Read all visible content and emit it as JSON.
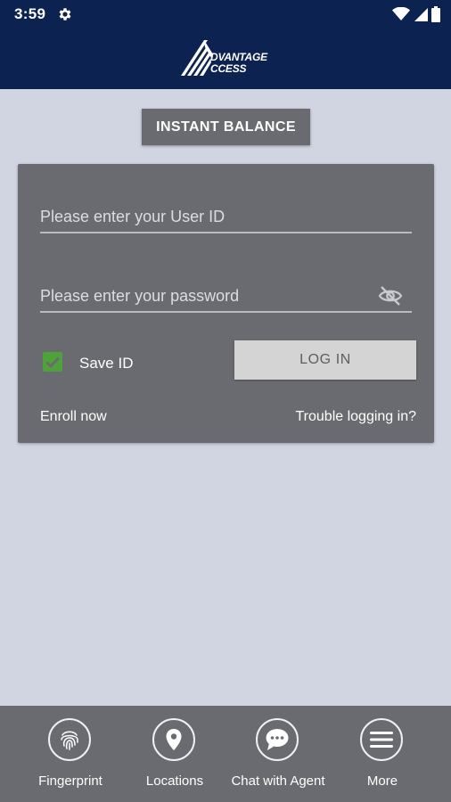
{
  "status_bar": {
    "time": "3:59",
    "icons": [
      "settings-gear",
      "wifi",
      "signal",
      "battery"
    ]
  },
  "header": {
    "logo_line1": "DVANTAGE",
    "logo_line2": "CCESS"
  },
  "instant_balance_label": "INSTANT BALANCE",
  "login": {
    "userid_placeholder": "Please enter your User ID",
    "userid_value": "",
    "password_placeholder": "Please enter your password",
    "password_value": "",
    "save_id_label": "Save ID",
    "save_id_checked": true,
    "login_button_label": "LOG IN",
    "enroll_label": "Enroll now",
    "trouble_label": "Trouble logging in?"
  },
  "bottom_nav": {
    "items": [
      {
        "label": "Fingerprint",
        "icon": "fingerprint-icon"
      },
      {
        "label": "Locations",
        "icon": "location-pin-icon"
      },
      {
        "label": "Chat with Agent",
        "icon": "chat-icon"
      },
      {
        "label": "More",
        "icon": "menu-icon"
      }
    ]
  },
  "colors": {
    "header_bg": "#0c2250",
    "page_bg": "#d1d5e2",
    "card_bg": "#6a6b70",
    "checkbox_green": "#4fa13a",
    "login_button_bg": "#d4d4d4"
  }
}
